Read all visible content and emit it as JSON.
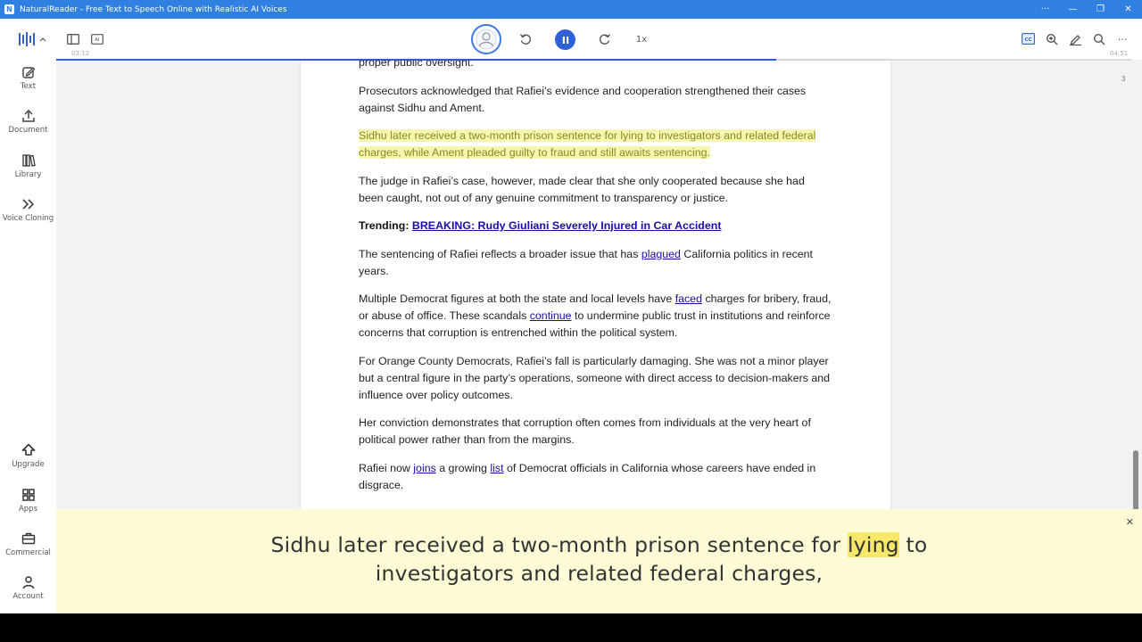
{
  "window": {
    "title": "NaturalReader - Free Text to Speech Online with Realistic AI Voices",
    "app_icon_letter": "N",
    "controls": [
      "···",
      "—",
      "❐",
      "✕"
    ]
  },
  "sidebar": {
    "items": [
      {
        "label": "Text",
        "icon": "edit-icon"
      },
      {
        "label": "Document",
        "icon": "upload-icon"
      },
      {
        "label": "Library",
        "icon": "library-icon"
      },
      {
        "label": "Voice Cloning",
        "icon": "voice-cloning-icon"
      }
    ],
    "bottom_items": [
      {
        "label": "Upgrade",
        "icon": "upgrade-icon"
      },
      {
        "label": "Apps",
        "icon": "apps-icon"
      },
      {
        "label": "Commercial",
        "icon": "briefcase-icon"
      },
      {
        "label": "Account",
        "icon": "account-icon"
      }
    ]
  },
  "toolbar": {
    "ai_label": "AI",
    "speed": "1x",
    "elapsed": "03:12",
    "remaining": "04:51",
    "progress": 0.67
  },
  "document": {
    "page_number": "3",
    "p0": "proper public oversight.",
    "p1": "Prosecutors acknowledged that Rafiei’s evidence and cooperation strengthened their cases against Sidhu and Ament.",
    "p2": "Sidhu later received a two-month prison sentence for lying to investigators and related federal charges, while Ament pleaded guilty to fraud and still awaits sentencing.",
    "p3": "The judge in Rafiei’s case, however, made clear that she only cooperated because she had been caught, not out of any genuine commitment to transparency or justice.",
    "trending_label": "Trending:",
    "trending_link": "BREAKING: Rudy Giuliani Severely Injured in Car Accident",
    "p5a": "The sentencing of Rafiei reflects a broader issue that has ",
    "p5link": "plagued",
    "p5b": " California politics in recent years.",
    "p6a": "Multiple Democrat figures at both the state and local levels have ",
    "p6link1": "faced",
    "p6b": " charges for bribery, fraud, or abuse of office. These scandals ",
    "p6link2": "continue",
    "p6c": " to undermine public trust in institutions and reinforce concerns that corruption is entrenched within the political system.",
    "p7": "For Orange County Democrats, Rafiei’s fall is particularly damaging. She was not a minor player but a central figure in the party’s operations, someone with direct access to decision-makers and influence over policy outcomes.",
    "p8": "Her conviction demonstrates that corruption often comes from individuals at the very heart of political power rather than from the margins.",
    "p9a": "Rafiei now ",
    "p9link1": "joins",
    "p9b": " a growing ",
    "p9link2": "list",
    "p9c": " of Democrat officials in California whose careers have ended in disgrace."
  },
  "caption": {
    "before": "Sidhu later received a two-month prison sentence for ",
    "word": "lying",
    "after_line1": " to",
    "line2": "investigators and related federal charges,",
    "close": "✕"
  },
  "colors": {
    "accent": "#2f80e1",
    "progress": "#2f60d8",
    "highlight_sentence": "#f6f6b0",
    "highlight_word": "#f7e86a",
    "caption_bg": "#fdfbd6",
    "link": "#1a0dab"
  }
}
